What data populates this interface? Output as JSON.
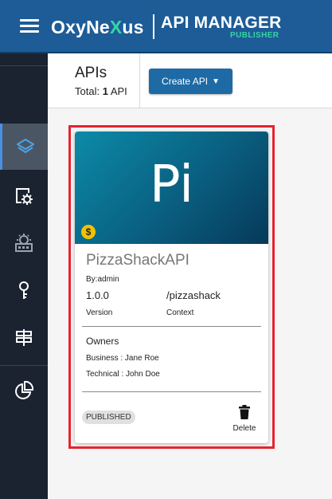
{
  "topbar": {
    "logo_prefix": "OxyNe",
    "logo_x": "X",
    "logo_suffix": "us",
    "app_title": "API MANAGER",
    "app_subtitle": "PUBLISHER"
  },
  "sidebar": {
    "items": [
      {
        "icon": "layers-icon",
        "active": true
      },
      {
        "icon": "settings-page-icon",
        "active": false
      },
      {
        "icon": "subscription-gear-icon",
        "active": false
      },
      {
        "icon": "key-icon",
        "active": false
      },
      {
        "icon": "signpost-icon",
        "active": false
      },
      {
        "icon": "analytics-pie-icon",
        "active": false
      }
    ]
  },
  "header": {
    "title": "APIs",
    "total_label": "Total:",
    "total_count": "1",
    "total_unit": "API",
    "create_button": "Create API",
    "create_caret": "▼"
  },
  "card": {
    "thumb_text": "Pi",
    "monetization_symbol": "$",
    "name": "PizzaShackAPI",
    "by": "By:admin",
    "version": "1.0.0",
    "version_label": "Version",
    "context": "/pizzashack",
    "context_label": "Context",
    "owners_title": "Owners",
    "business": "Business :  Jane Roe",
    "technical": "Technical :  John Doe",
    "status": "PUBLISHED",
    "delete_label": "Delete"
  },
  "colors": {
    "topbar": "#1d5c97",
    "sidebar": "#1b2331",
    "accent_green": "#39d4a6",
    "button": "#1d6aa5",
    "highlight": "#e8222f"
  }
}
